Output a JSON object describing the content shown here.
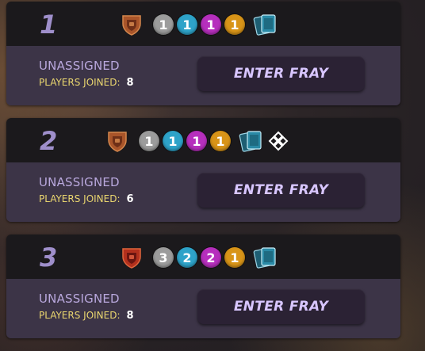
{
  "colors": {
    "number": "#9f8fcb",
    "status": "#b9a8dd",
    "players_label": "#ead66f",
    "button_text": "#d8c6ff",
    "rarity_common": "#9c9c9c",
    "rarity_rare": "#2ea3c9",
    "rarity_epic": "#b62fbd",
    "rarity_legendary": "#d89418"
  },
  "frays": [
    {
      "number": "1",
      "shield_icon": "bronze-shield-icon",
      "rarities": [
        "1",
        "1",
        "1",
        "1"
      ],
      "extra_icons": [
        "card-deck-icon"
      ],
      "status": "UNASSIGNED",
      "players_label": "PLAYERS JOINED:",
      "players_count": "8",
      "button_label": "ENTER FRAY"
    },
    {
      "number": "2",
      "shield_icon": "bronze-shield-icon",
      "rarities": [
        "1",
        "1",
        "1",
        "1"
      ],
      "extra_icons": [
        "card-deck-icon",
        "diamond-cross-icon"
      ],
      "status": "UNASSIGNED",
      "players_label": "PLAYERS JOINED:",
      "players_count": "6",
      "button_label": "ENTER FRAY"
    },
    {
      "number": "3",
      "shield_icon": "red-shield-icon",
      "rarities": [
        "3",
        "2",
        "2",
        "1"
      ],
      "extra_icons": [
        "card-deck-icon"
      ],
      "status": "UNASSIGNED",
      "players_label": "PLAYERS JOINED:",
      "players_count": "8",
      "button_label": "ENTER FRAY"
    }
  ]
}
